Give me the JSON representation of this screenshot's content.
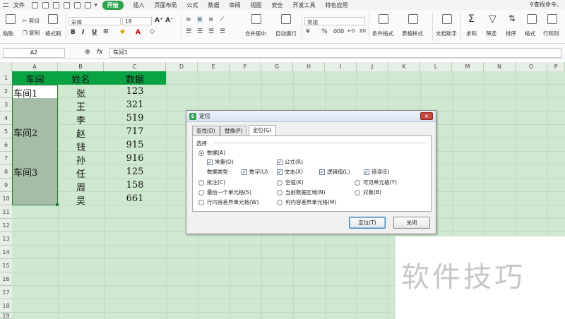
{
  "menubar": {
    "file": "文件",
    "tabs": [
      "开始",
      "插入",
      "页面布局",
      "公式",
      "数据",
      "审阅",
      "视图",
      "安全",
      "开发工具",
      "特色应用"
    ],
    "active_tab": "开始",
    "search": "查找命令、"
  },
  "ribbon": {
    "paste": "粘贴",
    "cut": "剪切",
    "copy": "复制",
    "format_painter": "格式刷",
    "font_name": "宋体",
    "font_size": "18",
    "merge_center": "合并居中",
    "wrap_text": "自动换行",
    "number_format": "常规",
    "cond_format": "条件格式",
    "table_style": "表格样式",
    "doc_helper": "文档助手",
    "sum": "求和",
    "filter": "筛选",
    "sort": "排序",
    "format": "格式",
    "row_col": "行和列"
  },
  "formula_bar": {
    "name_box": "A2",
    "fx": "fx",
    "content": "车间1"
  },
  "grid": {
    "columns": [
      "A",
      "B",
      "C",
      "D",
      "E",
      "F",
      "G",
      "H",
      "I",
      "J",
      "K",
      "L",
      "M",
      "N",
      "O",
      "P"
    ],
    "rows": [
      "1",
      "2",
      "3",
      "4",
      "5",
      "6",
      "7",
      "8",
      "9",
      "10",
      "11",
      "12",
      "13",
      "14",
      "15",
      "16",
      "17",
      "18",
      "19"
    ],
    "headers": {
      "a": "车间",
      "b": "姓名",
      "c": "数据"
    },
    "workshops": [
      "车间1",
      "车间2",
      "车间3"
    ],
    "names": [
      "张",
      "王",
      "李",
      "赵",
      "钱",
      "孙",
      "任",
      "周",
      "吴"
    ],
    "values": [
      "123",
      "321",
      "519",
      "717",
      "915",
      "916",
      "125",
      "158",
      "661"
    ],
    "header_color": "#0aa344"
  },
  "dialog": {
    "title": "定位",
    "close": "×",
    "tabs": [
      "查找(D)",
      "替换(P)",
      "定位(G)"
    ],
    "group": "选择",
    "data": "数据(A)",
    "constants": "常量(O)",
    "formulas": "公式(R)",
    "data_type": "数据类型:",
    "number": "数字(U)",
    "text": "文本(X)",
    "logical": "逻辑值(L)",
    "error": "错误(E)",
    "comments": "批注(C)",
    "blanks": "空值(K)",
    "visible": "可见单元格(Y)",
    "last_cell": "最后一个单元格(S)",
    "current_region": "当前数据区域(N)",
    "objects": "对象(B)",
    "row_diff": "行内容差异单元格(W)",
    "col_diff": "列内容差异单元格(M)",
    "ok": "定位(T)",
    "cancel": "关闭"
  },
  "watermark": "软件技巧"
}
